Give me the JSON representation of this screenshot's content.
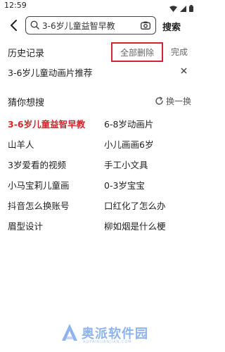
{
  "status": {
    "time": "12:59"
  },
  "search": {
    "query": "3-6岁儿童益智早教",
    "button": "搜索"
  },
  "history": {
    "title": "历史记录",
    "delete_all": "全部删除",
    "done": "完成",
    "items": [
      "3-6岁儿童动画片推荐"
    ]
  },
  "guess": {
    "title": "猜你想搜",
    "refresh": "换一换",
    "items": [
      [
        "3-6岁儿童益智早教",
        "6-8岁动画片"
      ],
      [
        "山羊人",
        "小儿画画6岁"
      ],
      [
        "3岁爱看的视频",
        "手工小文具"
      ],
      [
        "小马宝莉儿童画",
        "0-3岁宝宝"
      ],
      [
        "抖音怎么换账号",
        "口红化了怎么办"
      ],
      [
        "眉型设计",
        "柳如烟是什么梗"
      ]
    ]
  },
  "watermark": {
    "text": "奥派软件园",
    "sub": "AOPAIRUANJIAN.COM"
  },
  "colors": {
    "accent": "#d6232a",
    "watermark": "#8fb3ef"
  }
}
